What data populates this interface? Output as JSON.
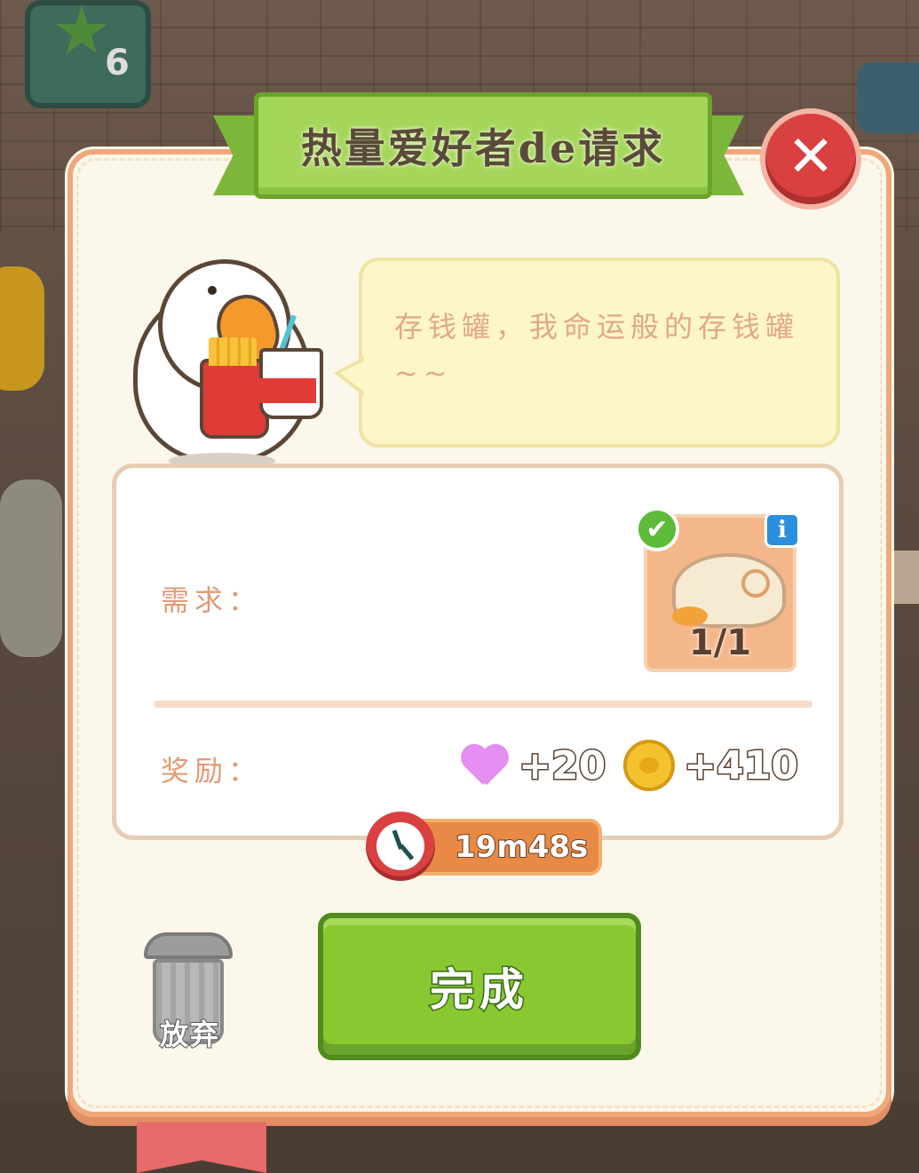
{
  "dialog": {
    "title": "热量爱好者de请求",
    "close_label": "✕"
  },
  "speech": {
    "text": "存钱罐，我命运般的存钱罐~~"
  },
  "requirement": {
    "label": "需求：",
    "item_icon": "steamed-bun-icon",
    "count": "1/1",
    "completed": true,
    "check_mark": "✔",
    "info_label": "i"
  },
  "reward": {
    "label": "奖励：",
    "heart_value": "+20",
    "coin_value": "+410",
    "heart_color": "#e58ef2",
    "coin_color": "#f4c22e"
  },
  "timer": {
    "value": "19m48s"
  },
  "actions": {
    "abandon_label": "放弃",
    "complete_label": "完成"
  },
  "background": {
    "badge_count": "6"
  },
  "colors": {
    "accent_green": "#8ac832",
    "panel_bg": "#fbf7ea",
    "close_red": "#d94040"
  }
}
